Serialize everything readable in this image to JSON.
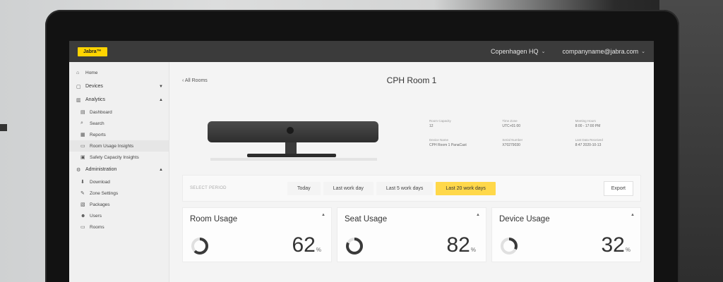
{
  "topbar": {
    "logo": "Jabra™",
    "location": "Copenhagen HQ",
    "account": "companyname@jabra.com"
  },
  "sidebar": {
    "items": [
      {
        "label": "Home",
        "icon": "home-icon",
        "type": "item"
      },
      {
        "label": "Devices",
        "icon": "devices-icon",
        "type": "section"
      },
      {
        "label": "Analytics",
        "icon": "analytics-icon",
        "type": "section"
      },
      {
        "label": "Dashboard",
        "icon": "dashboard-icon",
        "type": "sub"
      },
      {
        "label": "Search",
        "icon": "search-icon",
        "type": "sub"
      },
      {
        "label": "Reports",
        "icon": "reports-icon",
        "type": "sub"
      },
      {
        "label": "Room Usage Insights",
        "icon": "room-icon",
        "type": "sub",
        "active": true
      },
      {
        "label": "Safety Capacity Insights",
        "icon": "capacity-icon",
        "type": "sub"
      },
      {
        "label": "Administration",
        "icon": "admin-icon",
        "type": "section"
      },
      {
        "label": "Download",
        "icon": "download-icon",
        "type": "sub"
      },
      {
        "label": "Zone Settings",
        "icon": "settings-icon",
        "type": "sub"
      },
      {
        "label": "Packages",
        "icon": "packages-icon",
        "type": "sub"
      },
      {
        "label": "Users",
        "icon": "users-icon",
        "type": "sub"
      },
      {
        "label": "Rooms",
        "icon": "rooms-icon",
        "type": "sub"
      }
    ]
  },
  "header": {
    "back": "All Rooms",
    "title": "CPH Room 1"
  },
  "room_info": [
    {
      "label": "Room Capacity",
      "value": "12"
    },
    {
      "label": "Time Zone",
      "value": "UTC+01:00"
    },
    {
      "label": "Meeting Hours",
      "value": "8:00 - 17:00 PM"
    },
    {
      "label": "Device Name",
      "value": "CPH Room 1 PanaCast"
    },
    {
      "label": "Serial Number",
      "value": "X70279030"
    },
    {
      "label": "Last Data Received",
      "value": "8:47 2020-10-13"
    }
  ],
  "period": {
    "label": "SELECT PERIOD",
    "options": [
      "Today",
      "Last work day",
      "Last 5 work days",
      "Last 20 work days"
    ],
    "selected": "Last 20 work days",
    "export": "Export"
  },
  "cards": [
    {
      "title": "Room Usage",
      "value": "62",
      "unit": "%",
      "percent": 0.62
    },
    {
      "title": "Seat Usage",
      "value": "82",
      "unit": "%",
      "percent": 0.82
    },
    {
      "title": "Device Usage",
      "value": "32",
      "unit": "%",
      "percent": 0.32
    }
  ],
  "colors": {
    "accent": "#ffd84a",
    "topbar": "#3b3b3b",
    "gauge": "#3a3a3a",
    "gauge_track": "#e0e0e0"
  }
}
